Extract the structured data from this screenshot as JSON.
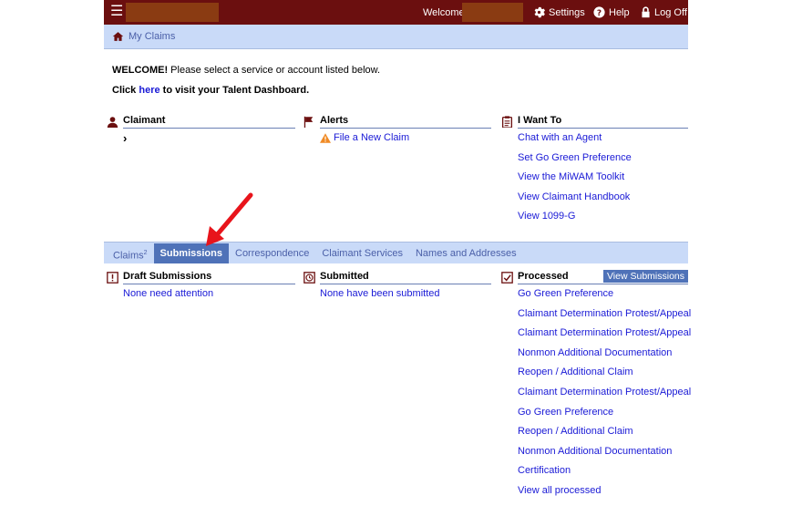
{
  "header": {
    "menu_icon": "hamburger-icon",
    "welcome_text": "Welcome,",
    "settings_label": "Settings",
    "help_label": "Help",
    "logoff_label": "Log Off"
  },
  "breadcrumb": {
    "label": "My Claims"
  },
  "intro": {
    "welcome_bold": "WELCOME!",
    "welcome_rest": " Please select a service or account listed below.",
    "click_text": "Click ",
    "here_link": "here",
    "dashboard_text": " to visit your Talent Dashboard."
  },
  "claimant": {
    "title": "Claimant",
    "chevron": "›"
  },
  "alerts": {
    "title": "Alerts",
    "items": [
      "File a New Claim"
    ]
  },
  "iwantto": {
    "title": "I Want To",
    "items": [
      "Chat with an Agent",
      "Set Go Green Preference",
      "View the MiWAM Toolkit",
      "View Claimant Handbook",
      "View 1099-G"
    ]
  },
  "tabs": {
    "items": [
      {
        "label": "Claims",
        "badge": "2"
      },
      {
        "label": "Submissions"
      },
      {
        "label": "Correspondence"
      },
      {
        "label": "Claimant Services"
      },
      {
        "label": "Names and Addresses"
      }
    ],
    "active": "Submissions"
  },
  "draft": {
    "title": "Draft Submissions",
    "items": [
      "None need attention"
    ]
  },
  "submitted": {
    "title": "Submitted",
    "items": [
      "None have been submitted"
    ]
  },
  "processed": {
    "title": "Processed",
    "view_button": "View Submissions",
    "items": [
      "Go Green Preference",
      "Claimant Determination Protest/Appeal",
      "Claimant Determination Protest/Appeal",
      "Nonmon Additional Documentation",
      "Reopen / Additional Claim",
      "Claimant Determination Protest/Appeal",
      "Go Green Preference",
      "Reopen / Additional Claim",
      "Nonmon Additional Documentation",
      "Certification",
      "View all processed"
    ]
  },
  "colors": {
    "topbar": "#6b0f0f",
    "band": "#c9daf8",
    "active_tab": "#4f72b8",
    "link": "#1a1ad6",
    "arrow": "#e8141b"
  }
}
